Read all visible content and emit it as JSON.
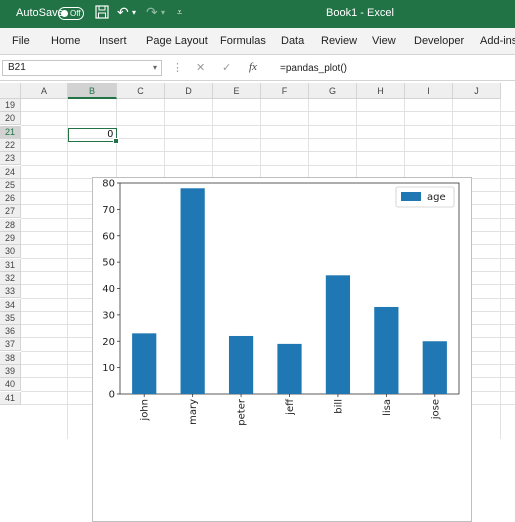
{
  "titlebar": {
    "autosave_label": "AutoSave",
    "autosave_state": "Off",
    "doc_title": "Book1",
    "separator": "-",
    "app_name": "Excel"
  },
  "ribbon": {
    "tabs": [
      "File",
      "Home",
      "Insert",
      "Page Layout",
      "Formulas",
      "Data",
      "Review",
      "View",
      "Developer",
      "Add-ins"
    ]
  },
  "formula_bar": {
    "name_box": "B21",
    "fx": "fx",
    "formula": "=pandas_plot()"
  },
  "sheet": {
    "columns": [
      "A",
      "B",
      "C",
      "D",
      "E",
      "F",
      "G",
      "H",
      "I",
      "J"
    ],
    "rows": [
      "19",
      "20",
      "21",
      "22",
      "23",
      "24",
      "25",
      "26",
      "27",
      "28",
      "29",
      "30",
      "31",
      "32",
      "33",
      "34",
      "35",
      "36",
      "37",
      "38",
      "39",
      "40",
      "41"
    ],
    "selected_column": "B",
    "selected_row": "21",
    "active_cell_value": "0"
  },
  "chart_data": {
    "type": "bar",
    "categories": [
      "john",
      "mary",
      "peter",
      "jeff",
      "bill",
      "lisa",
      "jose"
    ],
    "series": [
      {
        "name": "age",
        "values": [
          23,
          78,
          22,
          19,
          45,
          33,
          20
        ],
        "color": "#1f77b4"
      }
    ],
    "ylim": [
      0,
      80
    ],
    "yticks": [
      0,
      10,
      20,
      30,
      40,
      50,
      60,
      70,
      80
    ],
    "legend_position": "top-right"
  }
}
